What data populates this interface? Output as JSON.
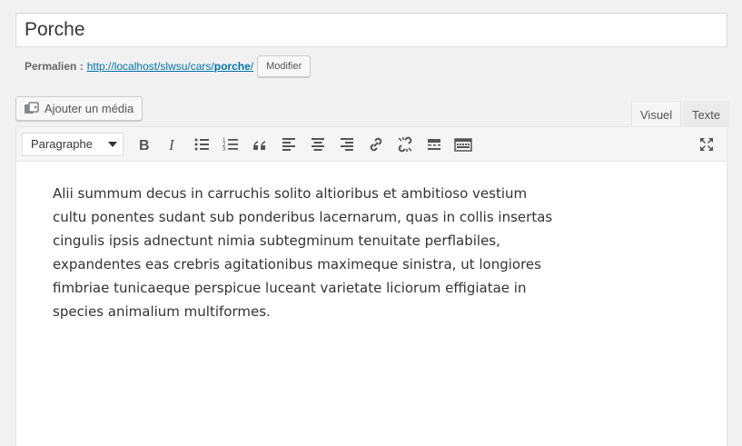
{
  "title": "Porche",
  "permalink": {
    "label": "Permalien :",
    "url_prefix": "http://localhost/slwsu/cars/",
    "slug": "porche",
    "url_suffix": "/",
    "edit_button": "Modifier"
  },
  "media_button": "Ajouter un média",
  "tabs": {
    "visual": "Visuel",
    "text": "Texte"
  },
  "toolbar": {
    "format_select": "Paragraphe",
    "buttons": [
      "bold-icon",
      "italic-icon",
      "bulleted-list-icon",
      "numbered-list-icon",
      "blockquote-icon",
      "align-left-icon",
      "align-center-icon",
      "align-right-icon",
      "link-icon",
      "unlink-icon",
      "read-more-icon",
      "toolbar-toggle-icon",
      "fullscreen-icon"
    ]
  },
  "content": "Alii summum decus in carruchis solito altioribus et ambitioso vestium cultu ponentes sudant sub ponderibus lacernarum, quas in collis insertas cingulis ipsis adnectunt nimia subtegminum tenuitate perflabiles, expandentes eas crebris agitationibus maximeque sinistra, ut longiores fimbriae tunicaeque perspicue luceant varietate liciorum effigiatae in species animalium multiformes."
}
